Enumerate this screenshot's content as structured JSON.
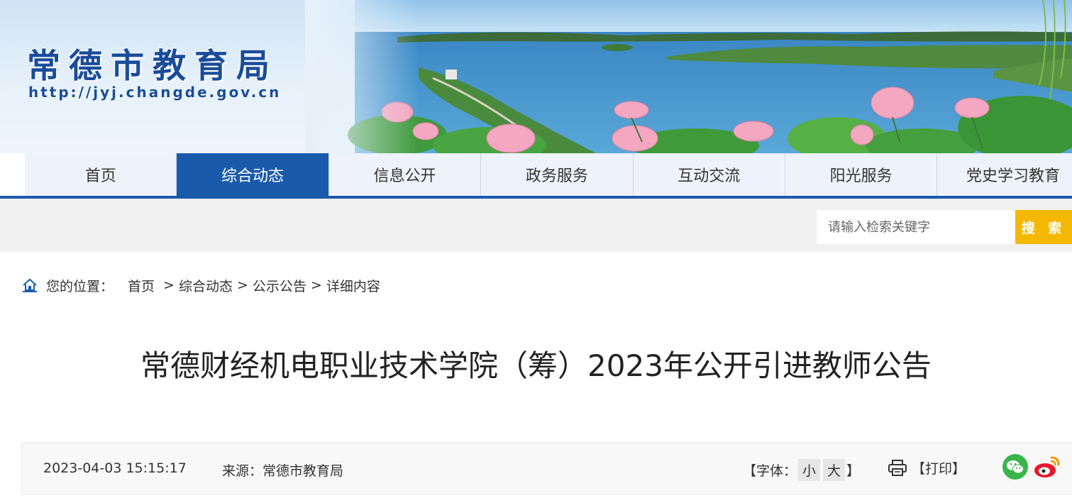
{
  "header": {
    "site_title": "常德市教育局",
    "site_url": "http://jyj.changde.gov.cn"
  },
  "nav": {
    "items": [
      {
        "label": "首页"
      },
      {
        "label": "综合动态"
      },
      {
        "label": "信息公开"
      },
      {
        "label": "政务服务"
      },
      {
        "label": "互动交流"
      },
      {
        "label": "阳光服务"
      },
      {
        "label": "党史学习教育"
      }
    ],
    "active_label": "综合动态"
  },
  "search": {
    "placeholder": "请输入检索关键字",
    "button_label": "搜 索"
  },
  "breadcrumb": {
    "label": "您的位置：",
    "items": [
      "首页",
      "综合动态",
      "公示公告",
      "详细内容"
    ],
    "separator": ">"
  },
  "article": {
    "title": "常德财经机电职业技术学院（筹）2023年公开引进教师公告",
    "date": "2023-04-03 15:15:17",
    "source_label": "来源：",
    "source": "常德市教育局",
    "font_label_open": "【字体：",
    "font_small": "小",
    "font_large": "大",
    "font_label_close": "】",
    "print_label": "【打印】"
  },
  "icons": {
    "home": "home-icon",
    "print": "printer-icon",
    "wechat": "wechat-icon",
    "weibo": "weibo-icon"
  },
  "colors": {
    "primary_blue": "#1a5aab",
    "search_yellow": "#f5b800",
    "wechat_green": "#3ab54a",
    "weibo_red": "#e6162d"
  }
}
